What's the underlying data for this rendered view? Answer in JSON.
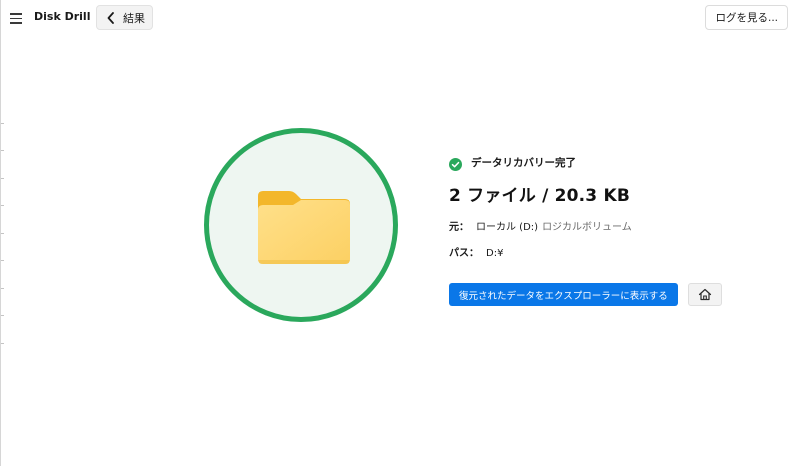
{
  "app": {
    "title": "Disk Drill"
  },
  "header": {
    "back_label": "結果",
    "log_button_label": "ログを見る..."
  },
  "result": {
    "status": "データリカバリー完了",
    "summary": "2 ファイル / 20.3 KB",
    "source_label": "元：",
    "source_drive": "ローカル (D:)",
    "source_volume": "ロジカルボリューム",
    "path_label": "パス：",
    "path_value": "D:¥"
  },
  "actions": {
    "show_in_explorer": "復元されたデータをエクスプローラーに表示する"
  },
  "icons": {
    "menu": "hamburger-icon",
    "back": "chevron-left-icon",
    "status": "check-circle-icon",
    "illustration": "folder-icon",
    "home": "home-icon"
  },
  "colors": {
    "accent": "#0a77e8",
    "success": "#2aa85c",
    "ring_fill": "#eef6f1",
    "folder_back": "#f3b72b",
    "folder_front": "#fdd36e"
  }
}
